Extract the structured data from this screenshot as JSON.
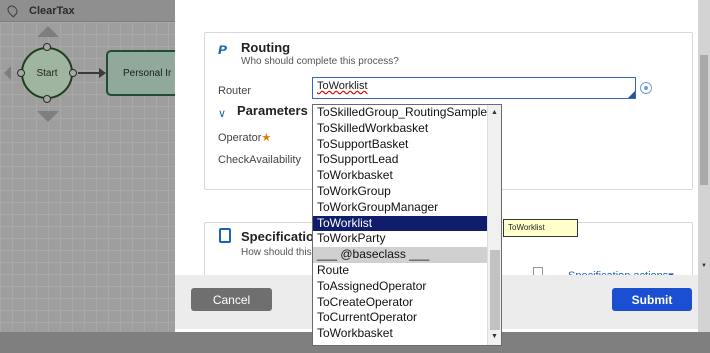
{
  "background": {
    "process_title": "ClearTax",
    "start_node_label": "Start",
    "step_node_label": "Personal Ir"
  },
  "routing": {
    "title": "Routing",
    "subtitle": "Who should complete this process?",
    "router_label": "Router",
    "router_value": "ToWorklist",
    "parameters_label": "Parameters",
    "operator_label": "Operator",
    "required_marker": "★",
    "check_availability_label": "CheckAvailability"
  },
  "specification": {
    "title": "Specification",
    "subtitle": "How should this",
    "actions_label": "Specification actions▾"
  },
  "footer": {
    "cancel_label": "Cancel",
    "submit_label": "Submit"
  },
  "tooltip": {
    "text": "ToWorklist"
  },
  "dropdown": {
    "options": [
      "ToSkilledGroup_RoutingSample",
      "ToSkilledWorkbasket",
      "ToSupportBasket",
      "ToSupportLead",
      "ToWorkbasket",
      "ToWorkGroup",
      "ToWorkGroupManager",
      "ToWorklist",
      "ToWorkParty",
      "___ @baseclass ___",
      "Route",
      "ToAssignedOperator",
      "ToCreateOperator",
      "ToCurrentOperator",
      "ToWorkbasket"
    ],
    "selected_index": 7,
    "separator_index": 9
  },
  "colors": {
    "accent": "#1a63b8",
    "selected_option": "#0f1d6b",
    "submit_button": "#1a4fd1",
    "cancel_button": "#6f6f6f"
  }
}
